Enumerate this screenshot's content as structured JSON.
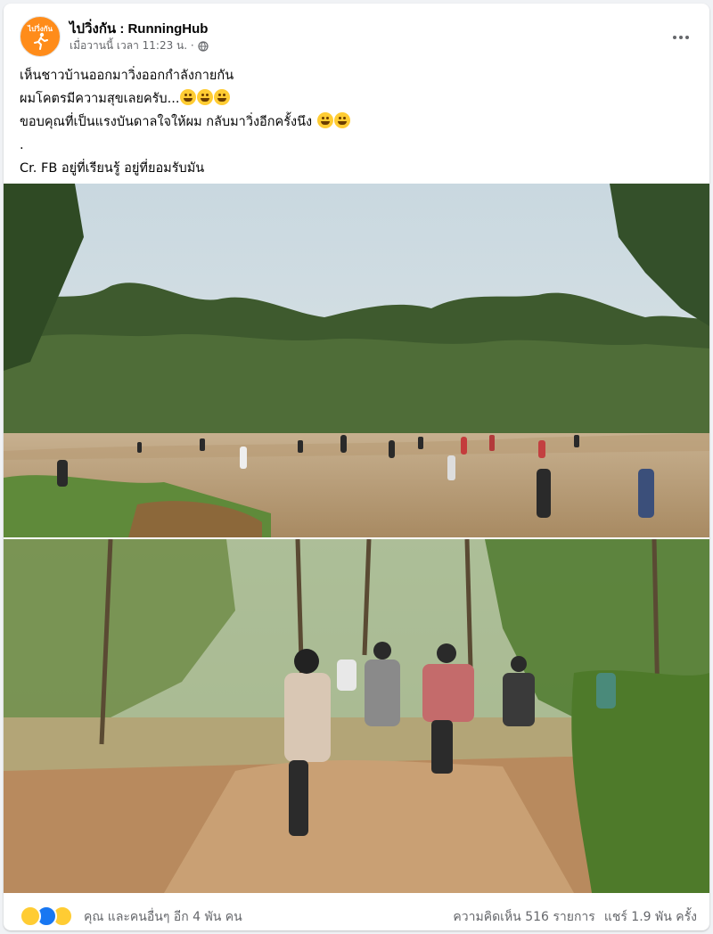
{
  "post": {
    "avatar_text": "ไปวิ่งกัน",
    "page_name": "ไปวิ่งกัน : RunningHub",
    "timestamp": "เมื่อวานนี้ เวลา 11:23 น. ·",
    "lines": [
      "เห็นชาวบ้านออกมาวิ่งออกกำลังกายกัน",
      "ผมโคตรมีความสุขเลยครับ...",
      "ขอบคุณที่เป็นแรงบันดาลใจให้ผม กลับมาวิ่งอีกครั้งนึง",
      ".",
      "Cr. FB อยู่ที่เรียนรู้ อยู่ที่ยอมรับมัน"
    ]
  },
  "icons": {
    "globe": "globe-icon",
    "more": "more-options-icon",
    "emoji": "laughing-emoji-icon"
  },
  "footer": {
    "reactions_text": "คุณ และคนอื่นๆ อีก 4 พัน คน",
    "comments": "ความคิดเห็น 516 รายการ",
    "shares": "แชร์ 1.9 พัน ครั้ง"
  },
  "colors": {
    "page_bg": "#f0f2f5",
    "card_bg": "#ffffff",
    "secondary_text": "#65676b",
    "avatar_orange": "#ff8c1a",
    "like_blue": "#1877f2"
  }
}
